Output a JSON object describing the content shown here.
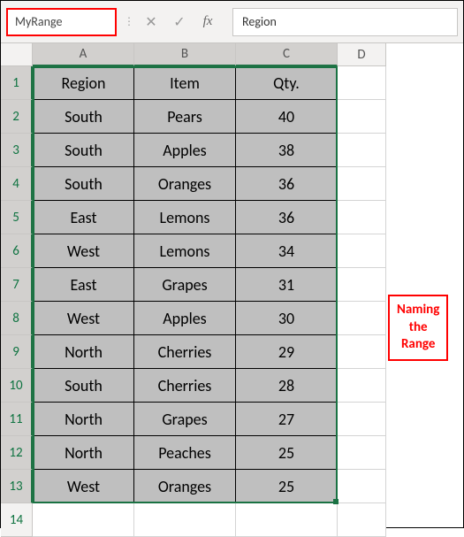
{
  "namebox": "MyRange",
  "formula": "Region",
  "colHeaders": [
    "A",
    "B",
    "C",
    "D"
  ],
  "rowHeaders": [
    "1",
    "2",
    "3",
    "4",
    "5",
    "6",
    "7",
    "8",
    "9",
    "10",
    "11",
    "12",
    "13",
    "14"
  ],
  "headerRow": {
    "region": "Region",
    "item": "Item",
    "qty": "Qty."
  },
  "rows": [
    {
      "region": "South",
      "item": "Pears",
      "qty": "40"
    },
    {
      "region": "South",
      "item": "Apples",
      "qty": "38"
    },
    {
      "region": "South",
      "item": "Oranges",
      "qty": "36"
    },
    {
      "region": "East",
      "item": "Lemons",
      "qty": "36"
    },
    {
      "region": "West",
      "item": "Lemons",
      "qty": "34"
    },
    {
      "region": "East",
      "item": "Grapes",
      "qty": "31"
    },
    {
      "region": "West",
      "item": "Apples",
      "qty": "30"
    },
    {
      "region": "North",
      "item": "Cherries",
      "qty": "29"
    },
    {
      "region": "South",
      "item": "Cherries",
      "qty": "28"
    },
    {
      "region": "North",
      "item": "Grapes",
      "qty": "27"
    },
    {
      "region": "North",
      "item": "Peaches",
      "qty": "25"
    },
    {
      "region": "West",
      "item": "Oranges",
      "qty": "25"
    }
  ],
  "annotation": {
    "l1": "Naming",
    "l2": "the",
    "l3": "Range"
  },
  "chart_data": {
    "type": "table",
    "columns": [
      "Region",
      "Item",
      "Qty."
    ],
    "data": [
      [
        "South",
        "Pears",
        40
      ],
      [
        "South",
        "Apples",
        38
      ],
      [
        "South",
        "Oranges",
        36
      ],
      [
        "East",
        "Lemons",
        36
      ],
      [
        "West",
        "Lemons",
        34
      ],
      [
        "East",
        "Grapes",
        31
      ],
      [
        "West",
        "Apples",
        30
      ],
      [
        "North",
        "Cherries",
        29
      ],
      [
        "South",
        "Cherries",
        28
      ],
      [
        "North",
        "Grapes",
        27
      ],
      [
        "North",
        "Peaches",
        25
      ],
      [
        "West",
        "Oranges",
        25
      ]
    ]
  }
}
